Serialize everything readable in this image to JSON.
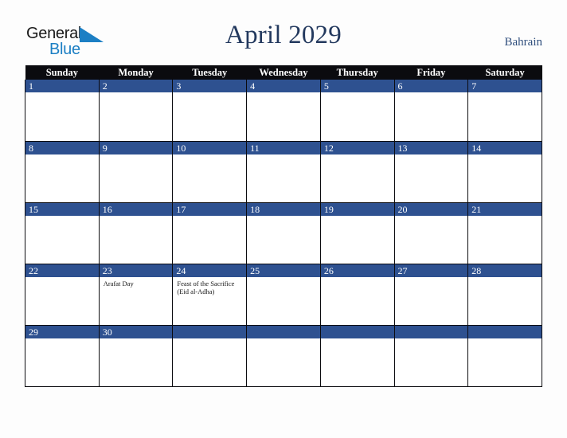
{
  "brand": {
    "name_part1": "General",
    "name_part2": "Blue",
    "triangle_color": "#1c7fc4",
    "text_color": "#1a1a1a"
  },
  "header": {
    "title": "April 2029",
    "country": "Bahrain",
    "title_color": "#23395e",
    "country_color": "#31507e"
  },
  "calendar": {
    "month": "April",
    "year": "2029",
    "accent_color": "#2e5190",
    "header_bg": "#0b0b0f",
    "weekdays": [
      "Sunday",
      "Monday",
      "Tuesday",
      "Wednesday",
      "Thursday",
      "Friday",
      "Saturday"
    ],
    "weeks": [
      [
        {
          "day": "1",
          "event": ""
        },
        {
          "day": "2",
          "event": ""
        },
        {
          "day": "3",
          "event": ""
        },
        {
          "day": "4",
          "event": ""
        },
        {
          "day": "5",
          "event": ""
        },
        {
          "day": "6",
          "event": ""
        },
        {
          "day": "7",
          "event": ""
        }
      ],
      [
        {
          "day": "8",
          "event": ""
        },
        {
          "day": "9",
          "event": ""
        },
        {
          "day": "10",
          "event": ""
        },
        {
          "day": "11",
          "event": ""
        },
        {
          "day": "12",
          "event": ""
        },
        {
          "day": "13",
          "event": ""
        },
        {
          "day": "14",
          "event": ""
        }
      ],
      [
        {
          "day": "15",
          "event": ""
        },
        {
          "day": "16",
          "event": ""
        },
        {
          "day": "17",
          "event": ""
        },
        {
          "day": "18",
          "event": ""
        },
        {
          "day": "19",
          "event": ""
        },
        {
          "day": "20",
          "event": ""
        },
        {
          "day": "21",
          "event": ""
        }
      ],
      [
        {
          "day": "22",
          "event": ""
        },
        {
          "day": "23",
          "event": "Arafat Day"
        },
        {
          "day": "24",
          "event": "Feast of the Sacrifice (Eid al-Adha)"
        },
        {
          "day": "25",
          "event": ""
        },
        {
          "day": "26",
          "event": ""
        },
        {
          "day": "27",
          "event": ""
        },
        {
          "day": "28",
          "event": ""
        }
      ],
      [
        {
          "day": "29",
          "event": ""
        },
        {
          "day": "30",
          "event": ""
        },
        {
          "day": "",
          "event": ""
        },
        {
          "day": "",
          "event": ""
        },
        {
          "day": "",
          "event": ""
        },
        {
          "day": "",
          "event": ""
        },
        {
          "day": "",
          "event": ""
        }
      ]
    ]
  }
}
